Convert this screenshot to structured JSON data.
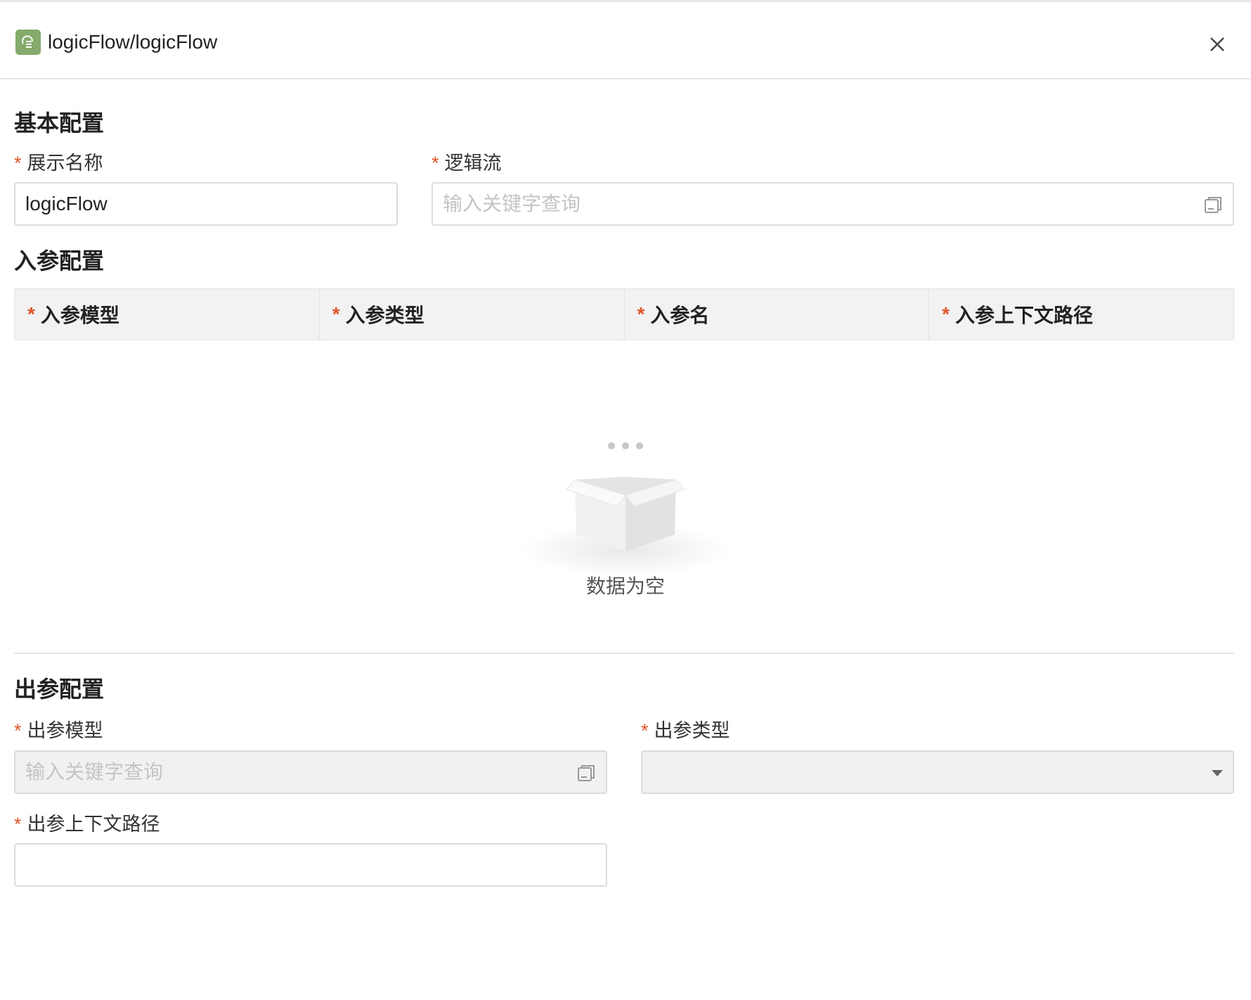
{
  "header": {
    "title": "logicFlow/logicFlow",
    "icon": "logic-flow-icon",
    "close_icon": "close-icon"
  },
  "basic_config": {
    "section_title": "基本配置",
    "display_name": {
      "label": "展示名称",
      "required_mark": "*",
      "value": "logicFlow"
    },
    "logic_flow": {
      "label": "逻辑流",
      "required_mark": "*",
      "placeholder": "输入关键字查询",
      "value": ""
    }
  },
  "input_params": {
    "section_title": "入参配置",
    "columns": [
      {
        "label": "入参模型",
        "required_mark": "*"
      },
      {
        "label": "入参类型",
        "required_mark": "*"
      },
      {
        "label": "入参名",
        "required_mark": "*"
      },
      {
        "label": "入参上下文路径",
        "required_mark": "*"
      }
    ],
    "rows": [],
    "empty_text": "数据为空"
  },
  "output_params": {
    "section_title": "出参配置",
    "model": {
      "label": "出参模型",
      "required_mark": "*",
      "placeholder": "输入关键字查询",
      "value": "",
      "disabled": true
    },
    "type": {
      "label": "出参类型",
      "required_mark": "*",
      "value": "",
      "disabled": true
    },
    "context_path": {
      "label": "出参上下文路径",
      "required_mark": "*",
      "value": ""
    }
  },
  "colors": {
    "accent_icon": "#84ab6c",
    "required_star": "#e0562c",
    "border": "#dcdcdc",
    "disabled_bg": "#f1f1f1"
  }
}
